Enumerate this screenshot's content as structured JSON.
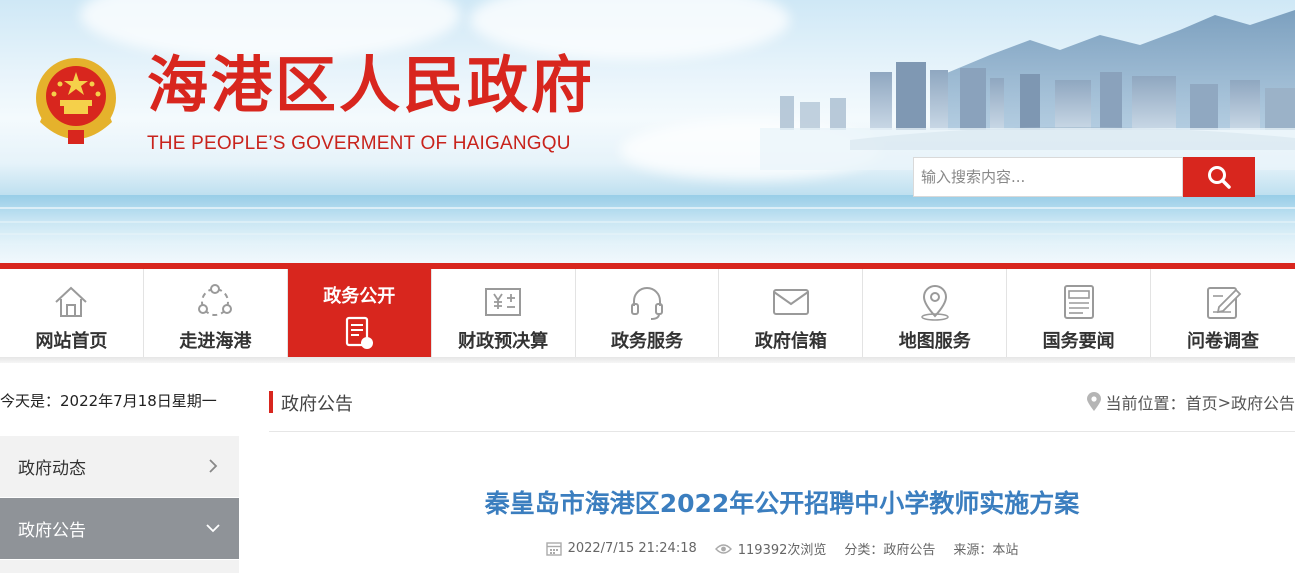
{
  "header": {
    "title_cn": "海港区人民政府",
    "title_en": "THE PEOPLE’S GOVERMENT OF HAIGANGQU",
    "search_placeholder": "输入搜索内容...",
    "brand_color": "#d8261e"
  },
  "nav": {
    "items": [
      {
        "label": "网站首页",
        "icon": "home-icon"
      },
      {
        "label": "走进海港",
        "icon": "people-network-icon"
      },
      {
        "label": "政务公开",
        "icon": "document-icon",
        "active": true
      },
      {
        "label": "财政预决算",
        "icon": "finance-yuan-icon"
      },
      {
        "label": "政务服务",
        "icon": "headset-icon"
      },
      {
        "label": "政府信箱",
        "icon": "mail-icon"
      },
      {
        "label": "地图服务",
        "icon": "map-pin-icon"
      },
      {
        "label": "国务要闻",
        "icon": "newspaper-icon"
      },
      {
        "label": "问卷调查",
        "icon": "survey-edit-icon"
      }
    ]
  },
  "sidebar": {
    "date_text": "今天是：2022年7月18日星期一",
    "items": [
      {
        "label": "政府动态",
        "icon": "chevron-right-icon"
      },
      {
        "label": "政府公告",
        "icon": "chevron-down-icon",
        "active": true
      }
    ]
  },
  "content": {
    "section_title": "政府公告",
    "location_label": "当前位置：",
    "location_home": "首页",
    "location_sep": ">",
    "location_current": "政府公告",
    "article_title": "秦皇岛市海港区2022年公开招聘中小学教师实施方案",
    "meta": {
      "datetime": "2022/7/15 21:24:18",
      "views": "119392次浏览",
      "category": "分类：政府公告",
      "source": "来源：本站"
    },
    "title_color": "#3b7ebf"
  }
}
